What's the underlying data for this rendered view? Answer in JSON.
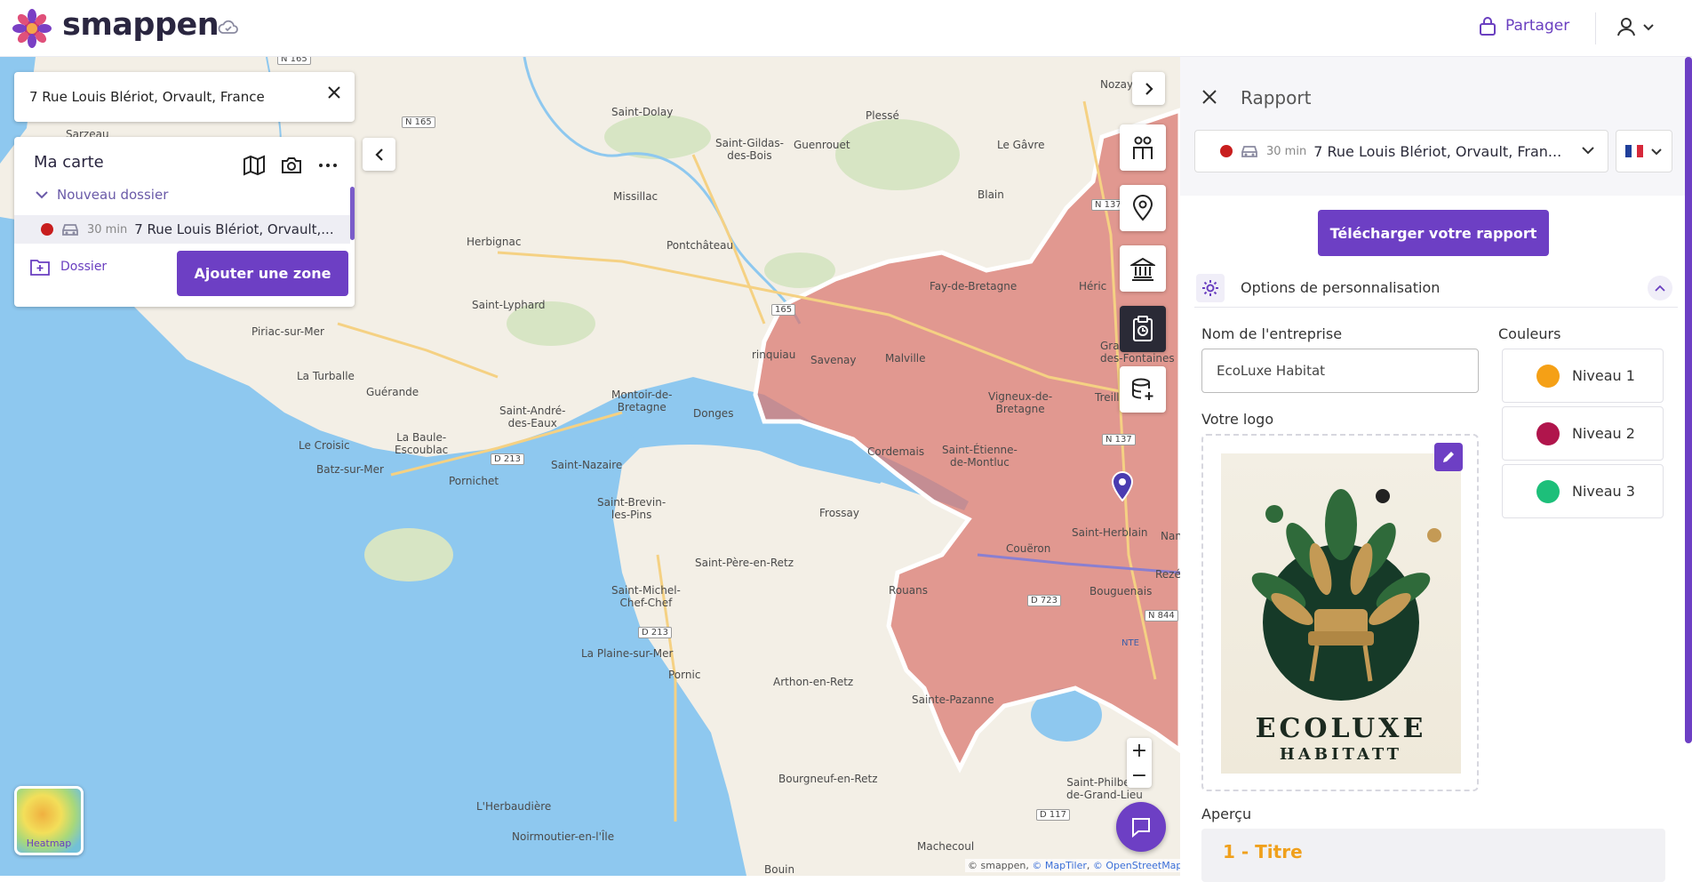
{
  "app": {
    "brand": "smappen",
    "share_label": "Partager"
  },
  "search": {
    "value": "7 Rue Louis Blériot, Orvault, France"
  },
  "panel": {
    "title": "Ma carte",
    "folder_label": "Nouveau dossier",
    "zone": {
      "minutes": "30 min",
      "address": "7 Rue Louis Blériot, Orvault,..."
    },
    "dossier_label": "Dossier",
    "add_zone_label": "Ajouter une zone"
  },
  "map": {
    "places": [
      {
        "id": "saint-dolay",
        "label": "Saint-Dolay"
      },
      {
        "id": "plesse",
        "label": "Plessé"
      },
      {
        "id": "nozay",
        "label": "Nozay"
      },
      {
        "id": "sarzeau",
        "label": "Sarzeau"
      },
      {
        "id": "saint-gildas",
        "label": "Saint-Gildas-\ndes-Bois"
      },
      {
        "id": "guenrouet",
        "label": "Guenrouet"
      },
      {
        "id": "le-gavre",
        "label": "Le Gâvre"
      },
      {
        "id": "missillac",
        "label": "Missillac"
      },
      {
        "id": "blain",
        "label": "Blain"
      },
      {
        "id": "herbignac",
        "label": "Herbignac"
      },
      {
        "id": "pontchateau",
        "label": "Pontchâteau"
      },
      {
        "id": "fay",
        "label": "Fay-de-Bretagne"
      },
      {
        "id": "heric",
        "label": "Héric"
      },
      {
        "id": "saint-lyphard",
        "label": "Saint-Lyphard"
      },
      {
        "id": "piriac",
        "label": "Piriac-sur-Mer"
      },
      {
        "id": "savenay",
        "label": "Savenay"
      },
      {
        "id": "malville",
        "label": "Malville"
      },
      {
        "id": "la-turballe",
        "label": "La Turballe"
      },
      {
        "id": "guerande",
        "label": "Guérande"
      },
      {
        "id": "montoir",
        "label": "Montoir-de-\nBretagne"
      },
      {
        "id": "donges",
        "label": "Donges"
      },
      {
        "id": "vigneux",
        "label": "Vigneux-de-\nBretagne"
      },
      {
        "id": "saint-andre",
        "label": "Saint-André-\ndes-Eaux"
      },
      {
        "id": "le-croisic",
        "label": "Le Croisic"
      },
      {
        "id": "la-baule",
        "label": "La Baule-\nEscoublac"
      },
      {
        "id": "batz",
        "label": "Batz-sur-Mer"
      },
      {
        "id": "saint-nazaire",
        "label": "Saint-Nazaire"
      },
      {
        "id": "pornichet",
        "label": "Pornichet"
      },
      {
        "id": "saint-etienne",
        "label": "Saint-Étienne-\nde-Montluc"
      },
      {
        "id": "cordemais",
        "label": "Cordemais"
      },
      {
        "id": "saint-brevin",
        "label": "Saint-Brevin-\nles-Pins"
      },
      {
        "id": "frossay",
        "label": "Frossay"
      },
      {
        "id": "saint-herblain",
        "label": "Saint-Herblain"
      },
      {
        "id": "coueron",
        "label": "Couëron"
      },
      {
        "id": "saint-pere",
        "label": "Saint-Père-en-Retz"
      },
      {
        "id": "saint-michel",
        "label": "Saint-Michel-\nChef-Chef"
      },
      {
        "id": "rouans",
        "label": "Rouans"
      },
      {
        "id": "bouguenais",
        "label": "Bouguenais"
      },
      {
        "id": "la-plaine",
        "label": "La Plaine-sur-Mer"
      },
      {
        "id": "pornic",
        "label": "Pornic"
      },
      {
        "id": "arthon",
        "label": "Arthon-en-Retz"
      },
      {
        "id": "sainte-pazanne",
        "label": "Sainte-Pazanne"
      },
      {
        "id": "bourgneuf",
        "label": "Bourgneuf-en-Retz"
      },
      {
        "id": "saint-philbert",
        "label": "Saint-Philbert-\nde-Grand-Lieu"
      },
      {
        "id": "lherbaudiere",
        "label": "L'Herbaudière"
      },
      {
        "id": "noirmoutier",
        "label": "Noirmoutier-en-l'Île"
      },
      {
        "id": "machecoul",
        "label": "Machecoul"
      },
      {
        "id": "bouin",
        "label": "Bouin"
      },
      {
        "id": "trinquiau",
        "label": "rinquiau"
      },
      {
        "id": "grandchamp",
        "label": "Gra\ndes-Fontaines"
      },
      {
        "id": "treillie",
        "label": "Treilli"
      },
      {
        "id": "nan",
        "label": "Nan"
      },
      {
        "id": "reze",
        "label": "Rezé"
      },
      {
        "id": "nte",
        "label": "NTE"
      }
    ],
    "roads": [
      {
        "id": "n165a",
        "label": "N 165"
      },
      {
        "id": "n165b",
        "label": "N 165"
      },
      {
        "id": "n137a",
        "label": "N 137"
      },
      {
        "id": "n137b",
        "label": "N 137"
      },
      {
        "id": "n165c",
        "label": "165"
      },
      {
        "id": "d213a",
        "label": "D 213"
      },
      {
        "id": "d213b",
        "label": "D 213"
      },
      {
        "id": "d723",
        "label": "D 723"
      },
      {
        "id": "n844",
        "label": "N 844"
      },
      {
        "id": "d117",
        "label": "D 117"
      }
    ],
    "zone_color": "#d9766f",
    "attribution": {
      "prefix": "© smappen, ",
      "maptiler": "© MapTiler",
      "osm": "© OpenStreetMap"
    },
    "heatmap_label": "Heatmap",
    "zoom_in": "+",
    "zoom_out": "−"
  },
  "report": {
    "title": "Rapport",
    "zone_minutes": "30 min",
    "zone_address": "7 Rue Louis Blériot, Orvault, Fran...",
    "download_label": "Télécharger votre rapport",
    "options_label": "Options de personnalisation",
    "company_label": "Nom de l'entreprise",
    "company_value": "EcoLuxe Habitat",
    "logo_label": "Votre logo",
    "logo_text_1": "ECOLUXE",
    "logo_text_2": "HABITATT",
    "colors_label": "Couleurs",
    "levels": [
      {
        "label": "Niveau 1",
        "color": "#f5a016"
      },
      {
        "label": "Niveau 2",
        "color": "#b0154c"
      },
      {
        "label": "Niveau 3",
        "color": "#1dbf7a"
      }
    ],
    "preview_label": "Aperçu",
    "preview_title": "1 - Titre"
  },
  "colors": {
    "accent": "#6d3fc4",
    "zone_dot": "#c81e1e"
  }
}
